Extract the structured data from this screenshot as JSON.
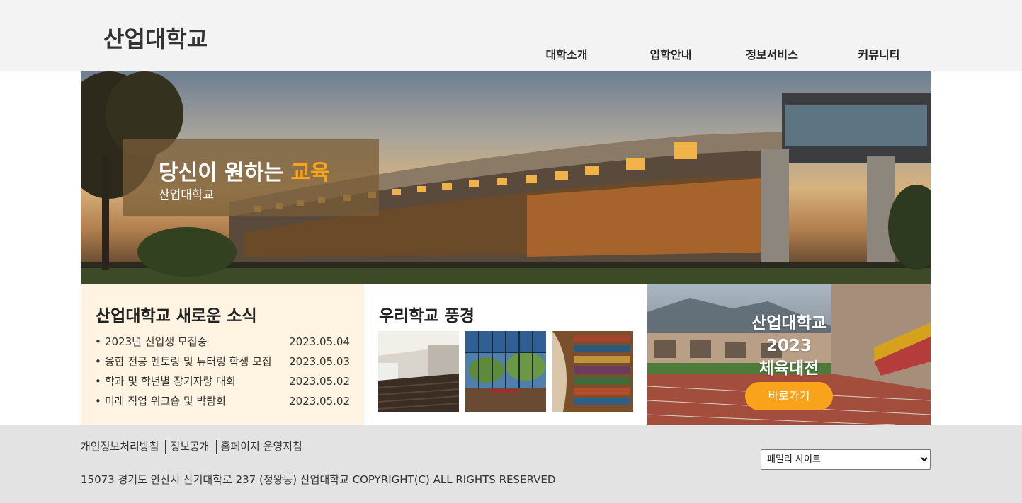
{
  "header": {
    "logo": "산업대학교",
    "nav": [
      "대학소개",
      "입학안내",
      "정보서비스",
      "커뮤니티"
    ]
  },
  "hero": {
    "title_prefix": "당신이 원하는 ",
    "title_accent": "교육",
    "subtitle": "산업대학교"
  },
  "news": {
    "heading": "산업대학교 새로운 소식",
    "items": [
      {
        "title": "2023년 신입생 모집중",
        "date": "2023.05.04"
      },
      {
        "title": "융합 전공 멘토링 및 튜터링 학생 모집",
        "date": "2023.05.03"
      },
      {
        "title": "학과 및 학년별 장기자랑 대회",
        "date": "2023.05.02"
      },
      {
        "title": "미래 직업 워크숍 및 박람회",
        "date": "2023.05.02"
      }
    ]
  },
  "gallery": {
    "heading": "우리학교 풍경",
    "images": [
      "lecture-hall",
      "library-atrium",
      "bookshelf"
    ]
  },
  "event": {
    "line1": "산업대학교",
    "line2": "2023",
    "line3": "체육대전",
    "button": "바로가기"
  },
  "footer": {
    "links": [
      "개인정보처리방침",
      "정보공개",
      "홈페이지 운영지침"
    ],
    "copyright": "15073 경기도 안산시 산기대학로 237 (정왕동) 산업대학교 COPYRIGHT(C) ALL RIGHTS RESERVED",
    "family_select": "패밀리 사이트"
  },
  "colors": {
    "accent": "#f8a31a",
    "header_bg": "#f3f3f3",
    "news_bg": "#fff4e1",
    "footer_bg": "#e3e3e3"
  }
}
